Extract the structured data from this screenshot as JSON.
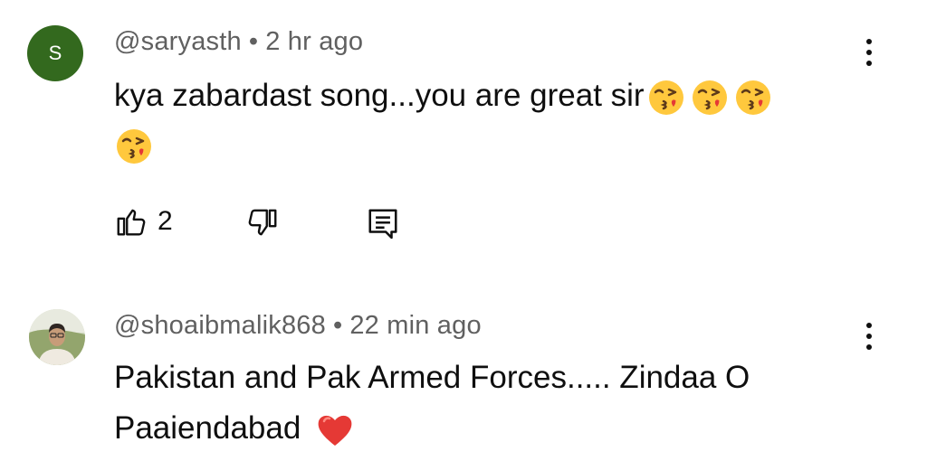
{
  "comments": [
    {
      "avatar_letter": "S",
      "avatar_color": "#33691e",
      "handle": "@saryasth",
      "separator": "•",
      "time": "2 hr ago",
      "text_line1": "kya zabardast song...you are great sir",
      "text_line2": "",
      "emoji_name": "face-blowing-a-kiss",
      "like_count": "2",
      "icons": [
        "like-icon",
        "dislike-icon",
        "reply-icon",
        "more-vert-icon"
      ]
    },
    {
      "avatar_description": "profile photo",
      "handle": "@shoaibmalik868",
      "separator": "•",
      "time": "22 min ago",
      "text_line1": "Pakistan and Pak Armed Forces..... Zindaa O",
      "text_line2": "Paaiendabad",
      "emoji_name": "red-heart",
      "icons": [
        "more-vert-icon"
      ]
    }
  ],
  "colors": {
    "text": "#0f0f0f",
    "meta": "#606060",
    "heart": "#e53935",
    "emoji_face": "#ffc83d"
  }
}
